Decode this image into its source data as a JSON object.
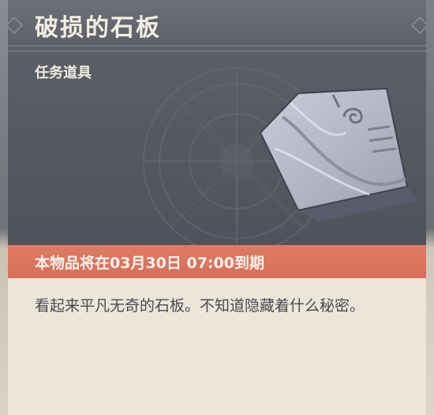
{
  "item": {
    "name": "破损的石板",
    "category": "任务道具",
    "expiry_notice": "本物品将在03月30日 07:00到期",
    "description": "看起来平凡无奇的石板。不知道隐藏着什么秘密。",
    "icon": "stone-slab-icon"
  },
  "colors": {
    "header_bg": "#5c5f66",
    "art_bg": "#555960",
    "expiry_bar": "#d86f58",
    "body_bg": "#ece5da",
    "title_text": "#f3eee4",
    "desc_text": "#4a4a50"
  }
}
